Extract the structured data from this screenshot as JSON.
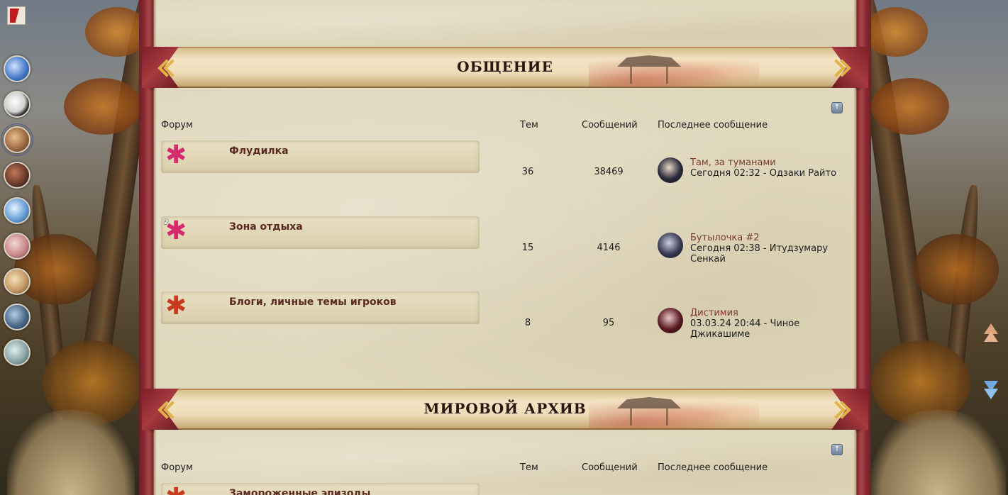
{
  "site": {
    "logo_icon": "bookmark-logo-icon"
  },
  "dock": {
    "avatars": [
      {
        "name": "feather-avatar",
        "color": "#3f74c4"
      },
      {
        "name": "panda-avatar",
        "color": "#d0d0d0"
      },
      {
        "name": "warrior-avatar",
        "color": "#a06a45"
      },
      {
        "name": "shadow-avatar",
        "color": "#6b3a2a"
      },
      {
        "name": "ice-avatar",
        "color": "#6aa0d8"
      },
      {
        "name": "pink-avatar",
        "color": "#c98a8a"
      },
      {
        "name": "blonde-avatar",
        "color": "#c69a66"
      },
      {
        "name": "city-avatar",
        "color": "#4a6a8a"
      },
      {
        "name": "glass-avatar",
        "color": "#8aa6a6"
      }
    ]
  },
  "categories": [
    {
      "title": "ОБЩЕНИЕ",
      "headers": {
        "forum": "Форум",
        "topics": "Тем",
        "posts": "Сообщений",
        "last": "Последнее сообщение"
      },
      "forums": [
        {
          "name": "Флудилка",
          "leaf": "pink",
          "badge": "",
          "topics": "36",
          "posts": "38469",
          "last_title": "Там, за туманами",
          "last_meta": "Сегодня 02:32 - Одзаки Райто",
          "avatar_color": "#2a2a3a"
        },
        {
          "name": "Зона отдыха",
          "leaf": "pink",
          "badge": "2",
          "topics": "15",
          "posts": "4146",
          "last_title": "Бутылочка #2",
          "last_meta": "Сегодня 02:38 - Итудзумару Сенкай",
          "avatar_color": "#3a3a52"
        },
        {
          "name": "Блоги, личные темы игроков",
          "leaf": "red",
          "badge": "",
          "topics": "8",
          "posts": "95",
          "last_title": "Дистимия",
          "last_meta": "03.03.24 20:44 - Чиное Джикашиме",
          "avatar_color": "#5a1a22"
        }
      ]
    },
    {
      "title": "МИРОВОЙ АРХИВ",
      "headers": {
        "forum": "Форум",
        "topics": "Тем",
        "posts": "Сообщений",
        "last": "Последнее сообщение"
      },
      "forums": [
        {
          "name": "Замороженные эпизоды",
          "leaf": "red"
        }
      ]
    }
  ],
  "colors": {
    "frame": "#8e2c33",
    "parchment": "#e0d8bd",
    "forum_link": "#5a2a22",
    "last_link": "#7a3a30"
  }
}
